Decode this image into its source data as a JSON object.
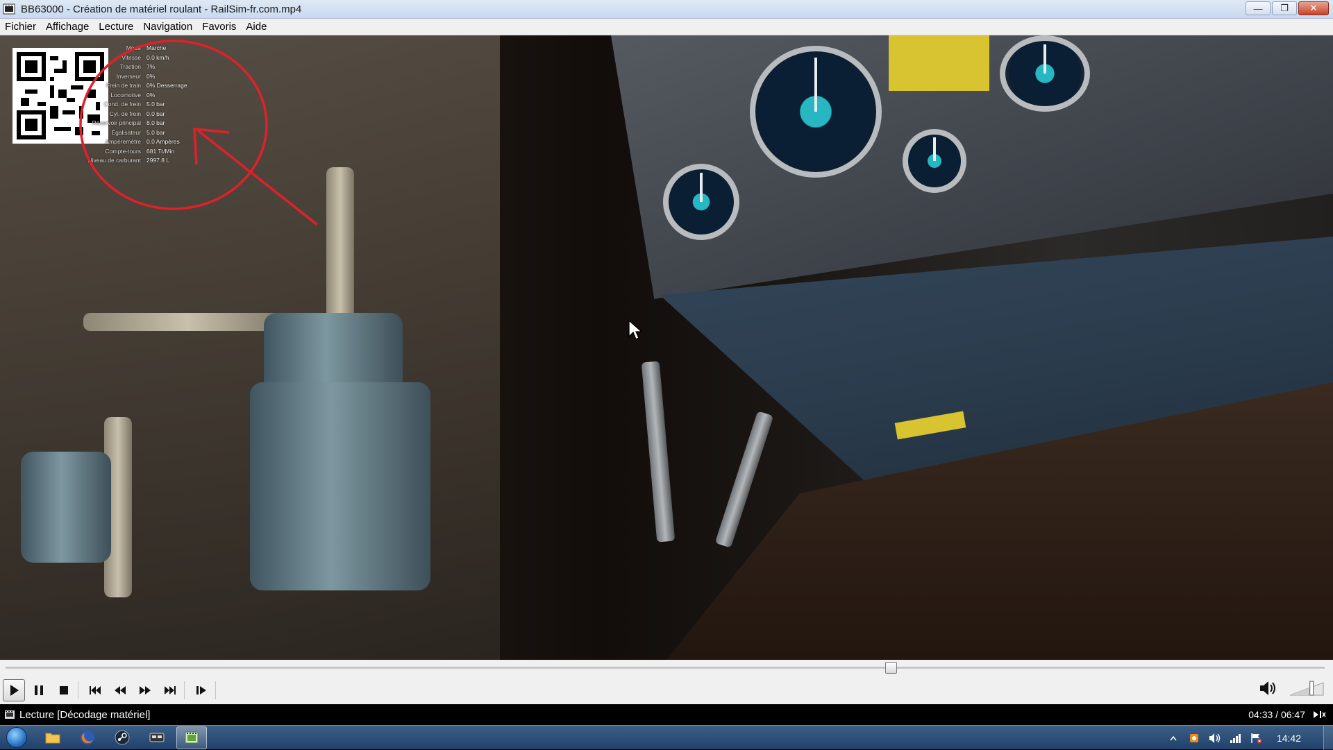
{
  "window": {
    "title": "BB63000 - Création de matériel roulant - RailSim-fr.com.mp4",
    "minimize": "—",
    "maximize": "❐",
    "close": "✕"
  },
  "menu": [
    "Fichier",
    "Affichage",
    "Lecture",
    "Navigation",
    "Favoris",
    "Aide"
  ],
  "hud": {
    "rows": [
      {
        "k": "Mode",
        "v": "Marche"
      },
      {
        "k": "Vitesse",
        "v": "0.0 km/h"
      },
      {
        "k": "Traction",
        "v": "7%"
      },
      {
        "k": "Inverseur",
        "v": "0%"
      },
      {
        "k": "Frein de train",
        "v": "0% Desserrage"
      },
      {
        "k": "Locomotive",
        "v": "0%"
      },
      {
        "k": "",
        "v": ""
      },
      {
        "k": "Cond. de frein",
        "v": "5.0 bar"
      },
      {
        "k": "Cyl. de frein",
        "v": "0.0 bar"
      },
      {
        "k": "Réservoir principal",
        "v": "8.0 bar"
      },
      {
        "k": "Égalisateur",
        "v": "5.0 bar"
      },
      {
        "k": "Ampèremètre",
        "v": "0.0 Ampères"
      },
      {
        "k": "Compte-tours",
        "v": "681 Tr/Min"
      },
      {
        "k": "Niveau de carburant",
        "v": "2997.8 L"
      }
    ]
  },
  "player": {
    "seek_position": 0.671,
    "volume_level": 0.65
  },
  "status": {
    "text": "Lecture [Décodage matériel]",
    "time": "04:33 / 06:47"
  },
  "taskbar": {
    "clock": "14:42",
    "apps": [
      "explorer",
      "firefox",
      "steam",
      "train-sim",
      "media-player-classic"
    ]
  },
  "colors": {
    "annotation_red": "#e0202a",
    "gauge_cyan": "#26b7c2"
  }
}
